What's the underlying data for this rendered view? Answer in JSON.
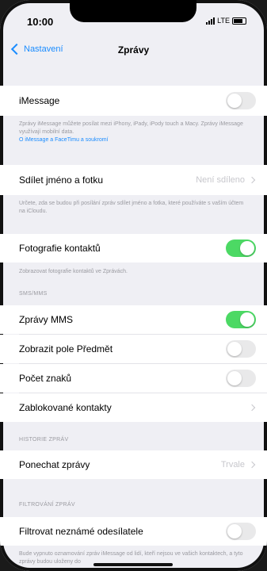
{
  "status": {
    "time": "10:00",
    "network": "LTE"
  },
  "nav": {
    "back_label": "Nastavení",
    "title": "Zprávy"
  },
  "imessage": {
    "label": "iMessage",
    "enabled": false,
    "footer": "Zprávy iMessage můžete posílat mezi iPhony, iPady, iPody touch a Macy. Zprávy iMessage využívají mobilní data.",
    "link": "O iMessage a FaceTimu a soukromí"
  },
  "share": {
    "label": "Sdílet jméno a fotku",
    "value": "Není sdíleno",
    "footer": "Určete, zda se budou při posílání zpráv sdílet jméno a fotka, které používáte s vaším účtem na iCloudu."
  },
  "contact_photos": {
    "label": "Fotografie kontaktů",
    "enabled": true,
    "footer": "Zobrazovat fotografie kontaktů ve Zprávách."
  },
  "sms_header": "SMS/MMS",
  "sms": {
    "mms_label": "Zprávy MMS",
    "mms_enabled": true,
    "subject_label": "Zobrazit pole Předmět",
    "subject_enabled": false,
    "count_label": "Počet znaků",
    "count_enabled": false,
    "blocked_label": "Zablokované kontakty"
  },
  "history_header": "HISTORIE ZPRÁV",
  "history": {
    "label": "Ponechat zprávy",
    "value": "Trvale"
  },
  "filter_header": "FILTROVÁNÍ ZPRÁV",
  "filter": {
    "label": "Filtrovat neznámé odesílatele",
    "enabled": false,
    "footer": "Bude vypnuto oznamování zpráv iMessage od lidí, kteří nejsou ve vašich kontaktech, a tyto zprávy budou uloženy do"
  }
}
